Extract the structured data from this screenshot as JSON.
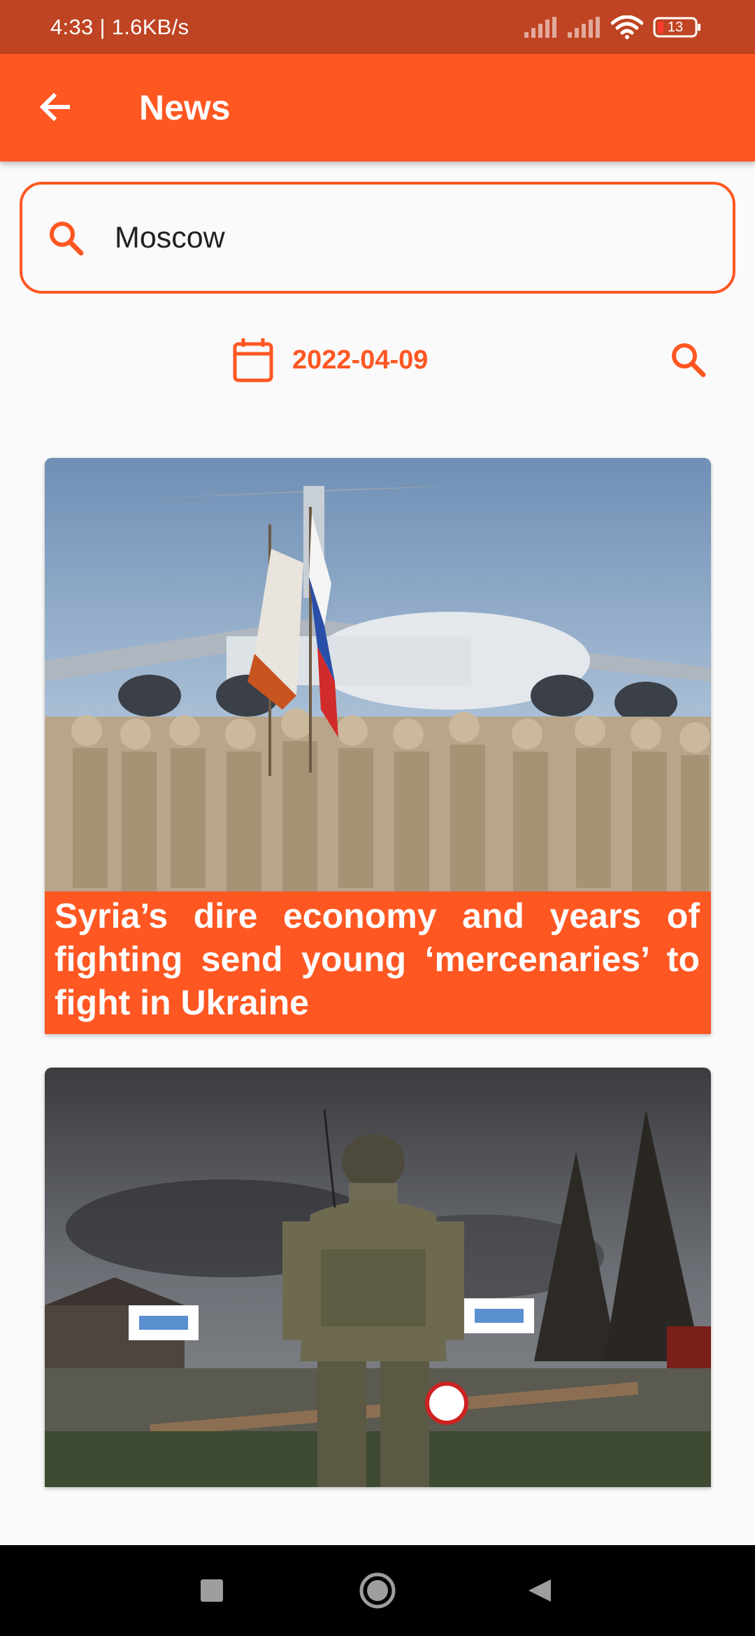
{
  "status_bar": {
    "time_speed": "4:33 | 1.6KB/s",
    "battery": "13",
    "icons": [
      "signal-icon",
      "signal-icon",
      "wifi-icon",
      "battery-icon"
    ]
  },
  "app_bar": {
    "title": "News",
    "back_icon": "arrow-left-icon"
  },
  "search": {
    "value": "Moscow",
    "icon": "search-icon"
  },
  "date_filter": {
    "date": "2022-04-09",
    "icon": "calendar-icon",
    "search_icon": "search-icon"
  },
  "articles": [
    {
      "title": "Syria’s dire economy and years of fighting send young ‘mercenaries’ to fight in Ukraine",
      "image": "soldiers-saluting-with-flags-in-front-of-cargo-plane"
    },
    {
      "title": "",
      "image": "soldier-in-camouflage-standing-on-road-with-smoke"
    }
  ],
  "nav_bar": {
    "icons": [
      "recents-square-icon",
      "home-circle-icon",
      "back-triangle-icon"
    ]
  },
  "colors": {
    "accent": "#ff5722",
    "status_bar": "#bf4423",
    "background": "#fafafa",
    "nav_bar": "#000000"
  }
}
